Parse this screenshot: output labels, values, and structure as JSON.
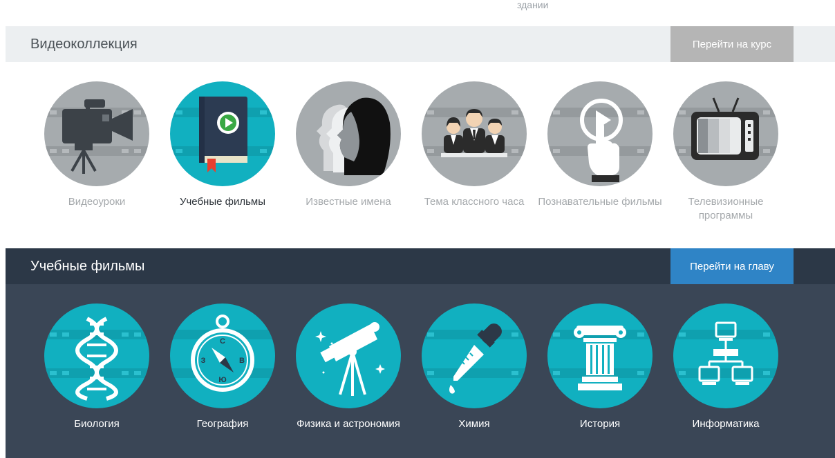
{
  "top_cut_text": "здании",
  "videocollection": {
    "title": "Видеоколлекция",
    "button": "Перейти на курс",
    "items": [
      {
        "label": "Видеоуроки",
        "icon": "video-camera-icon",
        "active": false
      },
      {
        "label": "Учебные фильмы",
        "icon": "book-play-icon",
        "active": true
      },
      {
        "label": "Известные имена",
        "icon": "profiles-icon",
        "active": false
      },
      {
        "label": "Тема классного часа",
        "icon": "students-icon",
        "active": false
      },
      {
        "label": "Познавательные фильмы",
        "icon": "touch-play-icon",
        "active": false
      },
      {
        "label": "Телевизионные программы",
        "icon": "tv-icon",
        "active": false
      }
    ]
  },
  "films": {
    "title": "Учебные фильмы",
    "button": "Перейти на главу",
    "items": [
      {
        "label": "Биология",
        "icon": "dna-icon"
      },
      {
        "label": "География",
        "icon": "compass-icon"
      },
      {
        "label": "Физика и астрономия",
        "icon": "telescope-icon"
      },
      {
        "label": "Химия",
        "icon": "pipette-icon"
      },
      {
        "label": "История",
        "icon": "column-icon"
      },
      {
        "label": "Информатика",
        "icon": "network-icon"
      }
    ]
  },
  "compass_letters": {
    "n": "С",
    "s": "Ю",
    "e": "В",
    "w": "З"
  },
  "colors": {
    "teal": "#11b0c0",
    "grey_circle": "#a6abae",
    "dark_header": "#2c3847",
    "dark_panel": "#3a4656",
    "blue_button": "#2f84c6",
    "grey_button": "#b5b5b5"
  }
}
